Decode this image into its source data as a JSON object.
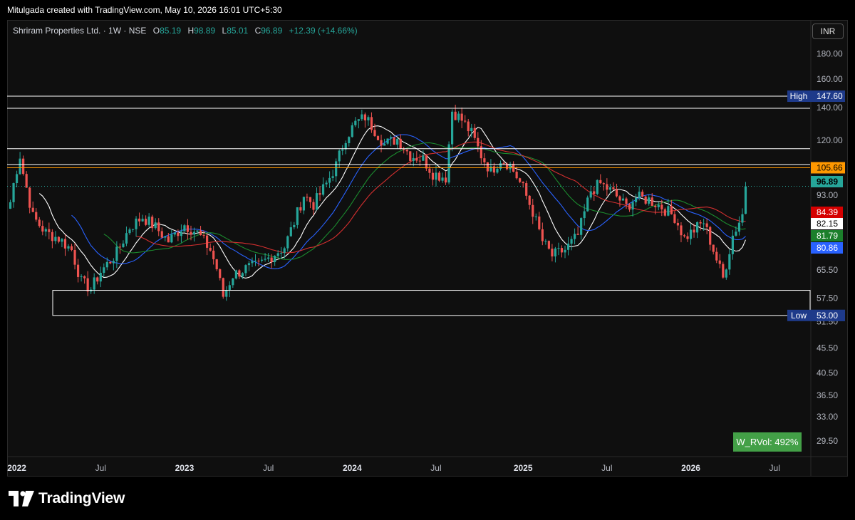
{
  "header": {
    "credit": "Mitulgada created with TradingView.com, May 10, 2026 16:01 UTC+5:30"
  },
  "legend": {
    "title": "Shriram Properties Ltd. · 1W · NSE",
    "o_key": "O",
    "o_val": "85.19",
    "h_key": "H",
    "h_val": "98.89",
    "l_key": "L",
    "l_val": "85.01",
    "c_key": "C",
    "c_val": "96.89",
    "change": "+12.39 (+14.66%)"
  },
  "currency": "INR",
  "rvol_label": "W_RVol: 492%",
  "footer": {
    "brand": "TradingView"
  },
  "colors": {
    "up": "#26a69a",
    "down": "#ef5350",
    "ema_white": "#ffffff",
    "ema_blue": "#2962ff",
    "ema_green": "#1b8a2e",
    "ema_red": "#d32f2f",
    "orange_level": "#ff9800",
    "badge_navy": "#1e3a8a"
  },
  "chart_data": {
    "type": "candlestick",
    "symbol": "Shriram Properties Ltd.",
    "interval": "1W",
    "exchange": "NSE",
    "scale": "log",
    "ylim": [
      27.5,
      192
    ],
    "xlim": [
      "2021-12-13",
      "2026-09-21"
    ],
    "price_ticks": [
      "180.00",
      "160.00",
      "140.00",
      "120.00",
      "105.66",
      "93.00",
      "65.50",
      "57.50",
      "51.50",
      "45.50",
      "40.50",
      "36.50",
      "33.00",
      "29.50"
    ],
    "x_ticks": [
      {
        "label": "2022",
        "date": "2022-01-03",
        "bold": true
      },
      {
        "label": "Jul",
        "date": "2022-07-04",
        "bold": false
      },
      {
        "label": "2023",
        "date": "2023-01-02",
        "bold": true
      },
      {
        "label": "Jul",
        "date": "2023-07-03",
        "bold": false
      },
      {
        "label": "2024",
        "date": "2024-01-01",
        "bold": true
      },
      {
        "label": "Jul",
        "date": "2024-07-01",
        "bold": false
      },
      {
        "label": "2025",
        "date": "2025-01-06",
        "bold": true
      },
      {
        "label": "Jul",
        "date": "2025-07-07",
        "bold": false
      },
      {
        "label": "2026",
        "date": "2026-01-05",
        "bold": true
      },
      {
        "label": "Jul",
        "date": "2026-07-06",
        "bold": false
      }
    ],
    "price_path": [
      [
        "2021-12-20",
        90
      ],
      [
        "2021-12-27",
        98
      ],
      [
        "2022-01-03",
        105
      ],
      [
        "2022-01-10",
        112
      ],
      [
        "2022-01-17",
        103
      ],
      [
        "2022-02-07",
        84
      ],
      [
        "2022-03-07",
        78
      ],
      [
        "2022-04-04",
        76
      ],
      [
        "2022-05-02",
        72
      ],
      [
        "2022-05-23",
        62
      ],
      [
        "2022-06-13",
        60
      ],
      [
        "2022-07-04",
        65
      ],
      [
        "2022-08-08",
        71
      ],
      [
        "2022-09-05",
        80
      ],
      [
        "2022-10-03",
        84
      ],
      [
        "2022-10-31",
        80
      ],
      [
        "2022-11-28",
        75
      ],
      [
        "2023-01-02",
        81
      ],
      [
        "2023-01-30",
        78
      ],
      [
        "2023-02-27",
        72
      ],
      [
        "2023-03-13",
        66
      ],
      [
        "2023-03-27",
        58
      ],
      [
        "2023-04-17",
        64
      ],
      [
        "2023-05-15",
        66
      ],
      [
        "2023-06-12",
        67
      ],
      [
        "2023-07-10",
        70
      ],
      [
        "2023-08-07",
        73
      ],
      [
        "2023-08-28",
        82
      ],
      [
        "2023-09-18",
        93
      ],
      [
        "2023-10-09",
        89
      ],
      [
        "2023-11-06",
        98
      ],
      [
        "2023-11-27",
        107
      ],
      [
        "2023-12-18",
        122
      ],
      [
        "2024-01-08",
        130
      ],
      [
        "2024-01-29",
        134
      ],
      [
        "2024-02-19",
        126
      ],
      [
        "2024-03-11",
        118
      ],
      [
        "2024-04-08",
        121
      ],
      [
        "2024-05-06",
        112
      ],
      [
        "2024-06-03",
        110
      ],
      [
        "2024-06-24",
        103
      ],
      [
        "2024-07-22",
        101
      ],
      [
        "2024-08-05",
        138
      ],
      [
        "2024-08-26",
        132
      ],
      [
        "2024-09-16",
        124
      ],
      [
        "2024-10-07",
        112
      ],
      [
        "2024-10-28",
        104
      ],
      [
        "2024-11-18",
        110
      ],
      [
        "2024-12-09",
        107
      ],
      [
        "2025-01-06",
        96
      ],
      [
        "2025-01-27",
        86
      ],
      [
        "2025-02-17",
        75
      ],
      [
        "2025-03-10",
        70
      ],
      [
        "2025-04-07",
        72
      ],
      [
        "2025-05-05",
        77
      ],
      [
        "2025-06-02",
        95
      ],
      [
        "2025-06-23",
        98
      ],
      [
        "2025-07-21",
        94
      ],
      [
        "2025-08-18",
        88
      ],
      [
        "2025-09-08",
        92
      ],
      [
        "2025-10-06",
        91
      ],
      [
        "2025-11-03",
        88
      ],
      [
        "2025-12-01",
        84
      ],
      [
        "2025-12-22",
        76
      ],
      [
        "2026-01-12",
        79
      ],
      [
        "2026-02-02",
        82
      ],
      [
        "2026-02-23",
        72
      ],
      [
        "2026-03-16",
        63
      ],
      [
        "2026-04-06",
        77
      ],
      [
        "2026-04-27",
        85
      ],
      [
        "2026-05-04",
        96.89
      ]
    ],
    "last_candle": {
      "open": 85.19,
      "high": 98.89,
      "low": 85.01,
      "close": 96.89,
      "change": "+12.39",
      "change_pct": "+14.66%"
    },
    "moving_averages": [
      {
        "color": "white",
        "period_weeks": 10,
        "last": 82.15
      },
      {
        "color": "blue",
        "period_weeks": 20,
        "last": 80.86
      },
      {
        "color": "green",
        "period_weeks": 30,
        "last": 81.79
      },
      {
        "color": "red",
        "period_weeks": 40,
        "last": 84.39
      }
    ],
    "horizontal_levels": [
      {
        "price": 147.6,
        "color": "#ffffff",
        "label": "High",
        "badge": "147.60"
      },
      {
        "price": 139.5,
        "color": "#ffffff"
      },
      {
        "price": 115.5,
        "color": "#ffffff"
      },
      {
        "price": 107.3,
        "color": "#ffffff"
      },
      {
        "price": 105.66,
        "color": "#ff9800",
        "badge": "105.66"
      }
    ],
    "price_badges": [
      {
        "text": "96.89",
        "price": 96.89,
        "bg": "#26a69a",
        "fg": "#000000"
      },
      {
        "text": "84.39",
        "price": 84.39,
        "bg": "#d50000",
        "fg": "#ffffff"
      },
      {
        "text": "82.15",
        "price": 82.15,
        "bg": "#ffffff",
        "fg": "#000000"
      },
      {
        "text": "81.79",
        "price": 81.79,
        "bg": "#1b7f2b",
        "fg": "#ffffff"
      },
      {
        "text": "80.86",
        "price": 80.86,
        "bg": "#2962ff",
        "fg": "#ffffff"
      }
    ],
    "support_zone": {
      "from": "2022-01-03",
      "to": "2026-09-21",
      "low": 53.0,
      "high": 59.6,
      "label": "Low",
      "badge": "53.00"
    }
  }
}
